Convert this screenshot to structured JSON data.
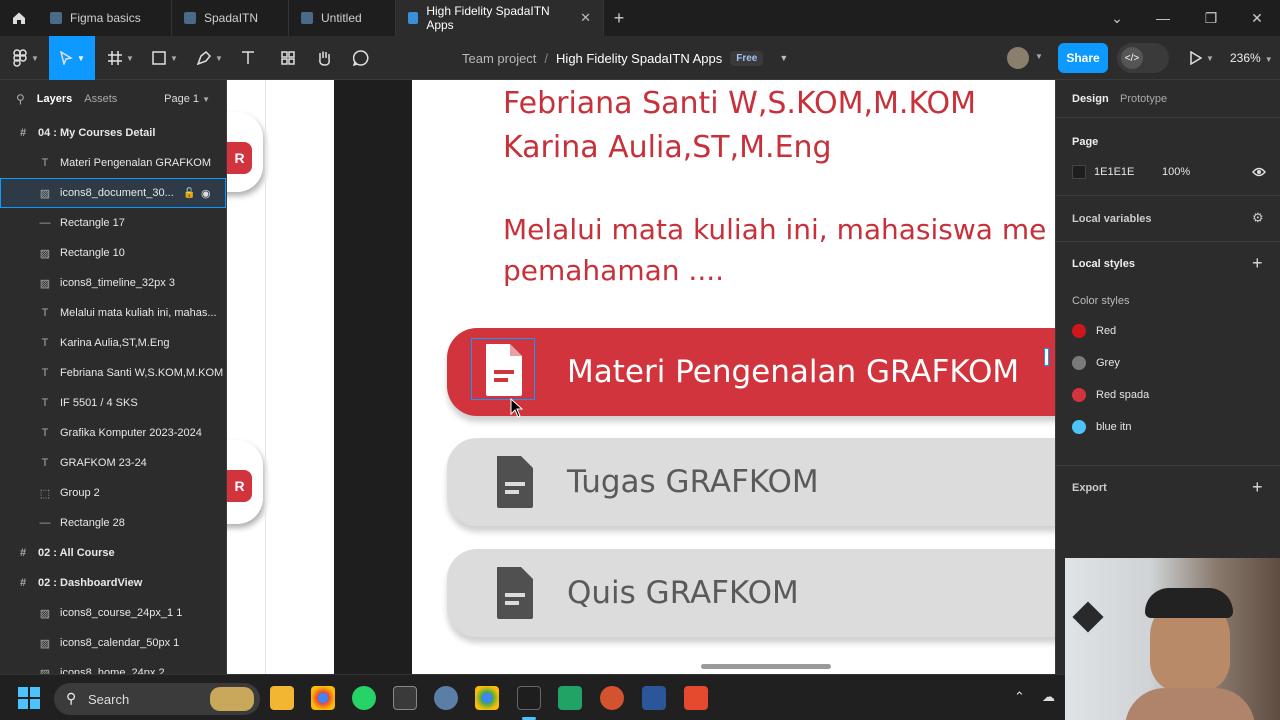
{
  "tabs": [
    {
      "label": "Figma basics",
      "active": false
    },
    {
      "label": "SpadaITN",
      "active": false
    },
    {
      "label": "Untitled",
      "active": false
    },
    {
      "label": "High Fidelity SpadaITN Apps",
      "active": true
    }
  ],
  "toolbar": {
    "project": "Team project",
    "separator": "/",
    "file": "High Fidelity SpadaITN Apps",
    "plan_badge": "Free",
    "share": "Share",
    "zoom": "236%"
  },
  "left_panel": {
    "tab_layers": "Layers",
    "tab_assets": "Assets",
    "page": "Page 1",
    "layers": [
      {
        "label": "04 : My Courses Detail",
        "icon": "frame-icon",
        "kind": "frame"
      },
      {
        "label": "Materi Pengenalan GRAFKOM",
        "icon": "text-icon",
        "kind": "child"
      },
      {
        "label": "icons8_document_30...",
        "icon": "image-icon",
        "kind": "child",
        "selected": true
      },
      {
        "label": "Rectangle 17",
        "icon": "line-icon",
        "kind": "child"
      },
      {
        "label": "Rectangle 10",
        "icon": "image-icon",
        "kind": "child"
      },
      {
        "label": "icons8_timeline_32px 3",
        "icon": "image-icon",
        "kind": "child"
      },
      {
        "label": "Melalui mata kuliah ini, mahas...",
        "icon": "text-icon",
        "kind": "child"
      },
      {
        "label": "Karina Aulia,ST,M.Eng",
        "icon": "text-icon",
        "kind": "child"
      },
      {
        "label": "Febriana Santi W,S.KOM,M.KOM",
        "icon": "text-icon",
        "kind": "child"
      },
      {
        "label": "IF 5501 / 4 SKS",
        "icon": "text-icon",
        "kind": "child"
      },
      {
        "label": "Grafika Komputer 2023-2024",
        "icon": "text-icon",
        "kind": "child"
      },
      {
        "label": "GRAFKOM 23-24",
        "icon": "text-icon",
        "kind": "child"
      },
      {
        "label": "Group 2",
        "icon": "group-icon",
        "kind": "child"
      },
      {
        "label": "Rectangle 28",
        "icon": "line-icon",
        "kind": "child"
      },
      {
        "label": "02 : All Course",
        "icon": "frame-icon",
        "kind": "frame"
      },
      {
        "label": "02 : DashboardView",
        "icon": "frame-icon",
        "kind": "frame"
      },
      {
        "label": "icons8_course_24px_1 1",
        "icon": "image-icon",
        "kind": "child"
      },
      {
        "label": "icons8_calendar_50px 1",
        "icon": "image-icon",
        "kind": "child"
      },
      {
        "label": "icons8_home_24px 2",
        "icon": "image-icon",
        "kind": "child"
      }
    ]
  },
  "canvas": {
    "lecturer1": "Febriana Santi W,S.KOM,M.KOM",
    "lecturer2": "Karina Aulia,ST,M.Eng",
    "desc1": "Melalui mata kuliah ini, mahasiswa me",
    "desc2": "pemahaman ....",
    "items": [
      {
        "label": "Materi Pengenalan GRAFKOM",
        "style": "red"
      },
      {
        "label": "Tugas GRAFKOM",
        "style": "grey"
      },
      {
        "label": "Quis GRAFKOM",
        "style": "grey"
      }
    ],
    "side_badge": "R"
  },
  "right_panel": {
    "tab_design": "Design",
    "tab_prototype": "Prototype",
    "page_title": "Page",
    "page_color": "1E1E1E",
    "page_opacity": "100%",
    "local_variables": "Local variables",
    "local_styles": "Local styles",
    "color_styles": "Color styles",
    "colors": [
      {
        "name": "Red",
        "hex": "#d0161d"
      },
      {
        "name": "Grey",
        "hex": "#7a7a7a"
      },
      {
        "name": "Red spada",
        "hex": "#d1343c"
      },
      {
        "name": "blue itn",
        "hex": "#4ec3f5"
      }
    ],
    "export": "Export"
  },
  "taskbar": {
    "search": "Search"
  },
  "colors": {
    "accent": "#0d99ff",
    "brand_red": "#d1343c"
  }
}
